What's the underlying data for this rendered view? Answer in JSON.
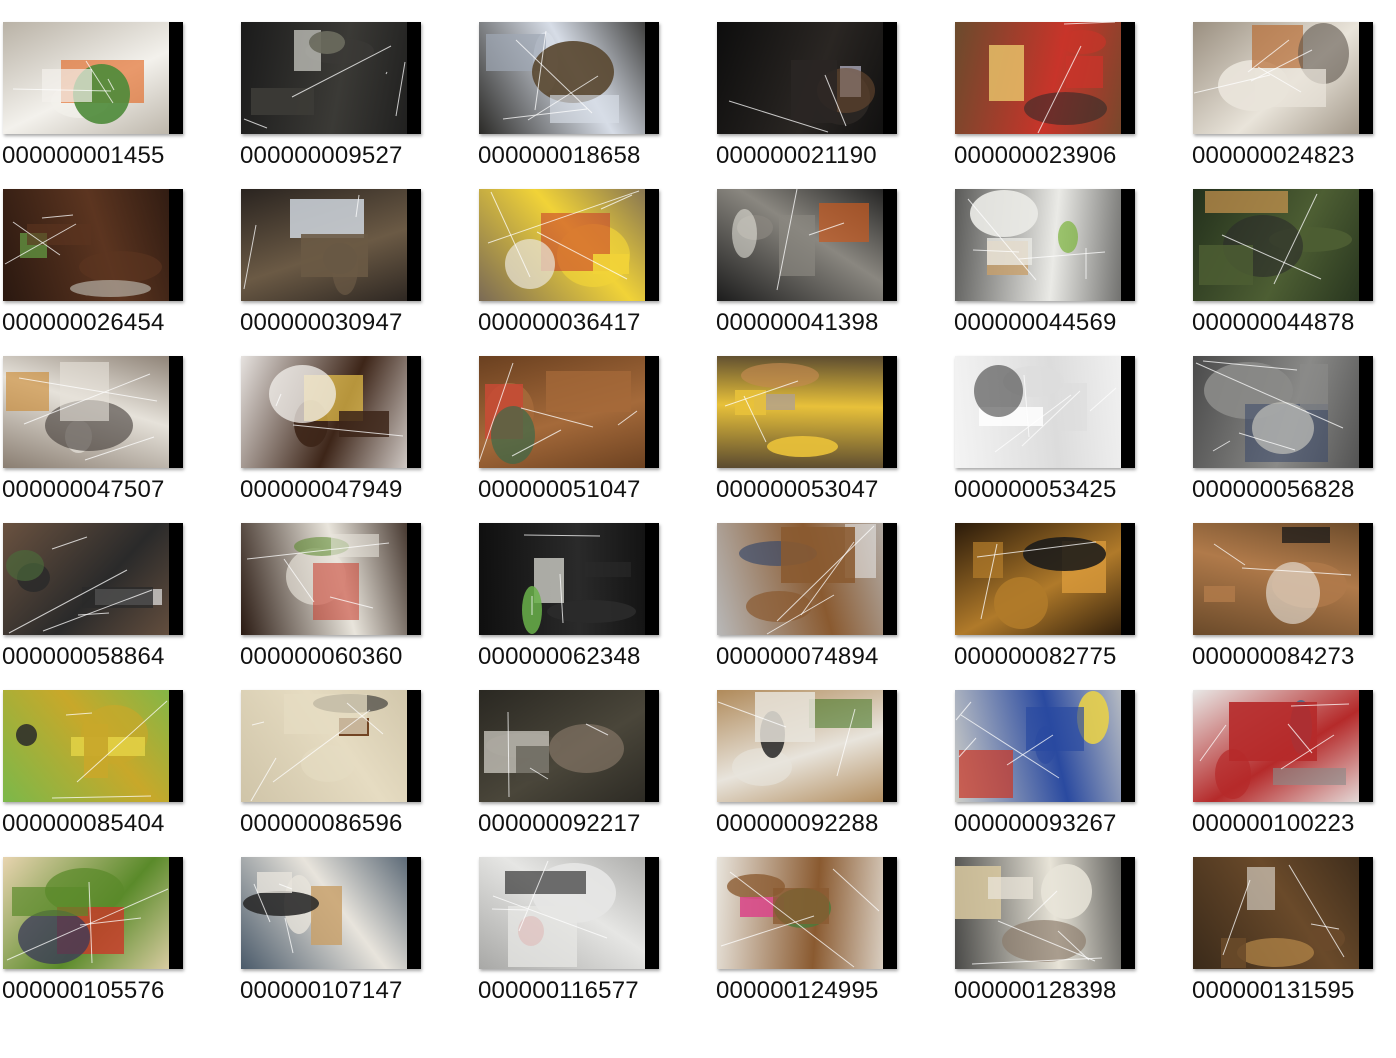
{
  "files": [
    {
      "name": "000000001455",
      "palette": [
        "#b9b2a6",
        "#f3f1ec",
        "#e2661f",
        "#4e8a3a"
      ]
    },
    {
      "name": "000000009527",
      "palette": [
        "#1b1b1b",
        "#3b3a36",
        "#c9c9c2",
        "#6a6a5e"
      ]
    },
    {
      "name": "000000018658",
      "palette": [
        "#2b2a27",
        "#d7dde7",
        "#a0a8b5",
        "#5b4a34"
      ]
    },
    {
      "name": "000000021190",
      "palette": [
        "#0d0d0d",
        "#2a2623",
        "#b9b6c9",
        "#6b4a30"
      ]
    },
    {
      "name": "000000023906",
      "palette": [
        "#6a4b2d",
        "#c8342a",
        "#e8c36a",
        "#2a2a2a"
      ]
    },
    {
      "name": "000000024823",
      "palette": [
        "#9a8f80",
        "#e9e4da",
        "#b86e36",
        "#5a5148"
      ]
    },
    {
      "name": "000000026454",
      "palette": [
        "#2a1810",
        "#5c3520",
        "#5e8a3c",
        "#c9c9c0"
      ]
    },
    {
      "name": "000000030947",
      "palette": [
        "#2a2420",
        "#6b5a45",
        "#cfd6de",
        "#4d4a44"
      ]
    },
    {
      "name": "000000036417",
      "palette": [
        "#7a6a55",
        "#f1d338",
        "#c93a2a",
        "#e9e4d6"
      ]
    },
    {
      "name": "000000041398",
      "palette": [
        "#1c1c1c",
        "#8a8780",
        "#c45a22",
        "#e4e2da"
      ]
    },
    {
      "name": "000000044569",
      "palette": [
        "#5a5a58",
        "#eaeae6",
        "#c9a06a",
        "#7bb33a"
      ]
    },
    {
      "name": "000000044878",
      "palette": [
        "#23301c",
        "#4d5e33",
        "#d39a52",
        "#2a2a2a"
      ]
    },
    {
      "name": "000000047507",
      "palette": [
        "#8a7e72",
        "#e6e2da",
        "#c9852a",
        "#3a3430"
      ]
    },
    {
      "name": "000000047949",
      "palette": [
        "#e6e2df",
        "#3d2518",
        "#e8c24a",
        "#f4f1ee"
      ]
    },
    {
      "name": "000000051047",
      "palette": [
        "#6a4020",
        "#a56a3a",
        "#c84a35",
        "#3a6a4a"
      ]
    },
    {
      "name": "000000053047",
      "palette": [
        "#5a4a30",
        "#e8c13a",
        "#b0a090",
        "#c48a52"
      ]
    },
    {
      "name": "000000053425",
      "palette": [
        "#f4f4f4",
        "#dcdcdc",
        "#ffffff",
        "#3a3a3a"
      ]
    },
    {
      "name": "000000056828",
      "palette": [
        "#4a4a4a",
        "#8a8a88",
        "#3a4a6a",
        "#bdbdb8"
      ]
    },
    {
      "name": "000000058864",
      "palette": [
        "#6a5240",
        "#2a2a2a",
        "#e8e8e8",
        "#4a6a3a"
      ]
    },
    {
      "name": "000000060360",
      "palette": [
        "#2a1a12",
        "#e9e5dc",
        "#c83a2a",
        "#5a8a2a"
      ]
    },
    {
      "name": "000000062348",
      "palette": [
        "#0f0f0f",
        "#2a2a2a",
        "#e4e4dc",
        "#6ab24a"
      ]
    },
    {
      "name": "000000074894",
      "palette": [
        "#b8b8b8",
        "#8a5a30",
        "#e6e6e6",
        "#3a4a6a"
      ]
    },
    {
      "name": "000000082775",
      "palette": [
        "#2a1a0a",
        "#b07a2a",
        "#d99a3a",
        "#1a1a1a"
      ]
    },
    {
      "name": "000000084273",
      "palette": [
        "#6a4a2a",
        "#b07a4a",
        "#1a1a1a",
        "#e8e4dc"
      ]
    },
    {
      "name": "000000085404",
      "palette": [
        "#7bb84a",
        "#c8a82a",
        "#e8d84a",
        "#2a2a2a"
      ]
    },
    {
      "name": "000000086596",
      "palette": [
        "#cfc4a8",
        "#e6dcc2",
        "#6a3a1a",
        "#2a2a2a"
      ]
    },
    {
      "name": "000000092217",
      "palette": [
        "#2a2822",
        "#4a463a",
        "#e8e4dc",
        "#8a7a6a"
      ]
    },
    {
      "name": "000000092288",
      "palette": [
        "#b08a5a",
        "#e8e4dc",
        "#4a7a2a",
        "#2a2a2a"
      ]
    },
    {
      "name": "000000093267",
      "palette": [
        "#cfcfc8",
        "#2a4aa0",
        "#c83a2a",
        "#e8d04a"
      ]
    },
    {
      "name": "000000100223",
      "palette": [
        "#e8e8e6",
        "#b52a2a",
        "#8a8a88",
        "#4a6a8a"
      ]
    },
    {
      "name": "000000105576",
      "palette": [
        "#e8d4b0",
        "#5a8a2a",
        "#c83a2a",
        "#3a3a5a"
      ]
    },
    {
      "name": "000000107147",
      "palette": [
        "#4a5a6a",
        "#e8e4dc",
        "#c8a06a",
        "#2a2a2a"
      ]
    },
    {
      "name": "000000116577",
      "palette": [
        "#a8a8a6",
        "#e6e6e4",
        "#2a2a2a",
        "#c82a2a"
      ]
    },
    {
      "name": "000000124995",
      "palette": [
        "#e8e4dc",
        "#8a5a30",
        "#d84a8a",
        "#4a7a3a"
      ]
    },
    {
      "name": "000000128398",
      "palette": [
        "#4a4a48",
        "#e8e4d8",
        "#d8c8a0",
        "#8a7a6a"
      ]
    },
    {
      "name": "000000131595",
      "palette": [
        "#3a2a1a",
        "#6a4a2a",
        "#e8e4dc",
        "#b88a4a"
      ]
    }
  ]
}
